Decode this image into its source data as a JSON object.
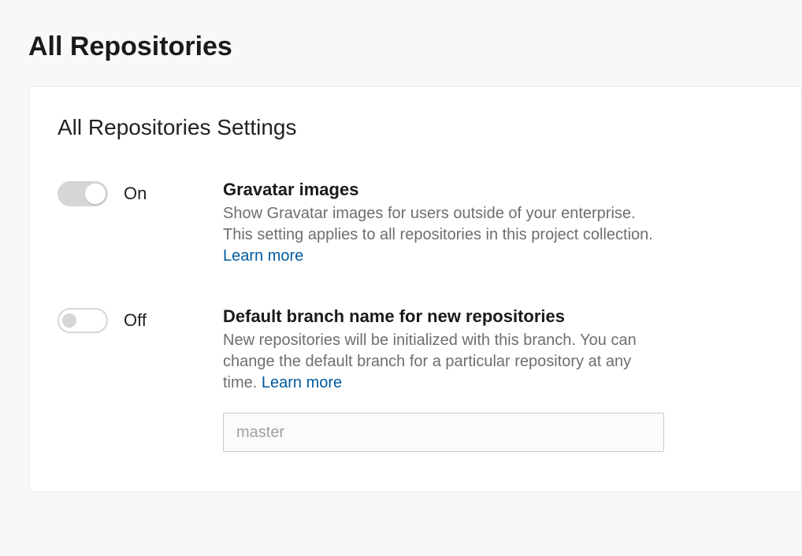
{
  "page": {
    "title": "All Repositories"
  },
  "card": {
    "title": "All Repositories Settings"
  },
  "settings": {
    "gravatar": {
      "state": "on",
      "state_label": "On",
      "title": "Gravatar images",
      "description": "Show Gravatar images for users outside of your enterprise. This setting applies to all repositories in this project collection. ",
      "learn_more": "Learn more"
    },
    "default_branch": {
      "state": "off",
      "state_label": "Off",
      "title": "Default branch name for new repositories",
      "description": "New repositories will be initialized with this branch. You can change the default branch for a particular repository at any time. ",
      "learn_more": "Learn more",
      "input_placeholder": "master",
      "input_value": ""
    }
  }
}
